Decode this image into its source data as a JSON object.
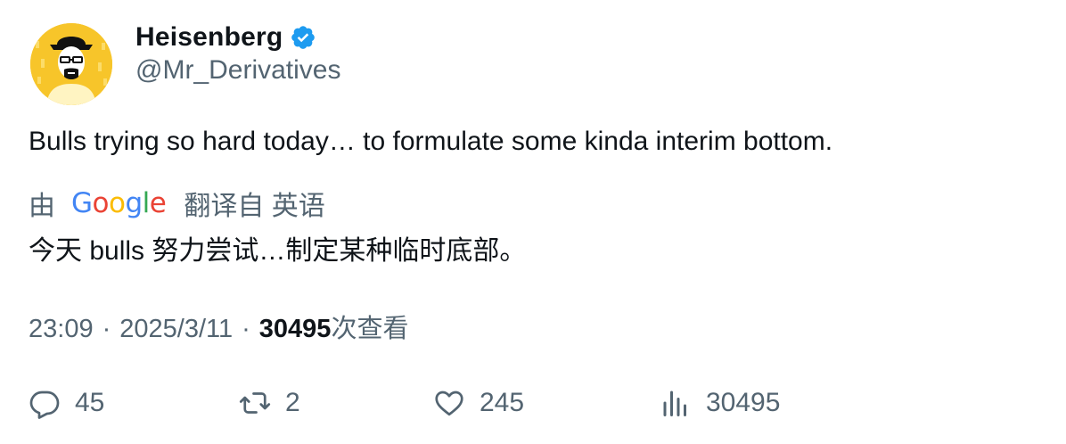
{
  "author": {
    "display_name": "Heisenberg",
    "handle": "@Mr_Derivatives",
    "avatar_icon": "avatar-heisenberg",
    "verified_icon": "verified-badge-icon",
    "verified_color": "#1d9bf0"
  },
  "tweet": {
    "text": "Bulls trying so hard today… to formulate some kinda interim bottom."
  },
  "translation": {
    "by_label": "由",
    "provider": "Google",
    "from_label": "翻译自 英语",
    "text": "今天 bulls 努力尝试…制定某种临时底部。"
  },
  "meta": {
    "time": "23:09",
    "separator": "·",
    "date": "2025/3/11",
    "views_count": "30495",
    "views_label": "次查看"
  },
  "actions": {
    "replies": "45",
    "retweets": "2",
    "likes": "245",
    "views": "30495"
  },
  "colors": {
    "text_primary": "#0f1419",
    "text_secondary": "#536471",
    "avatar_bg": "#f7c52a"
  }
}
